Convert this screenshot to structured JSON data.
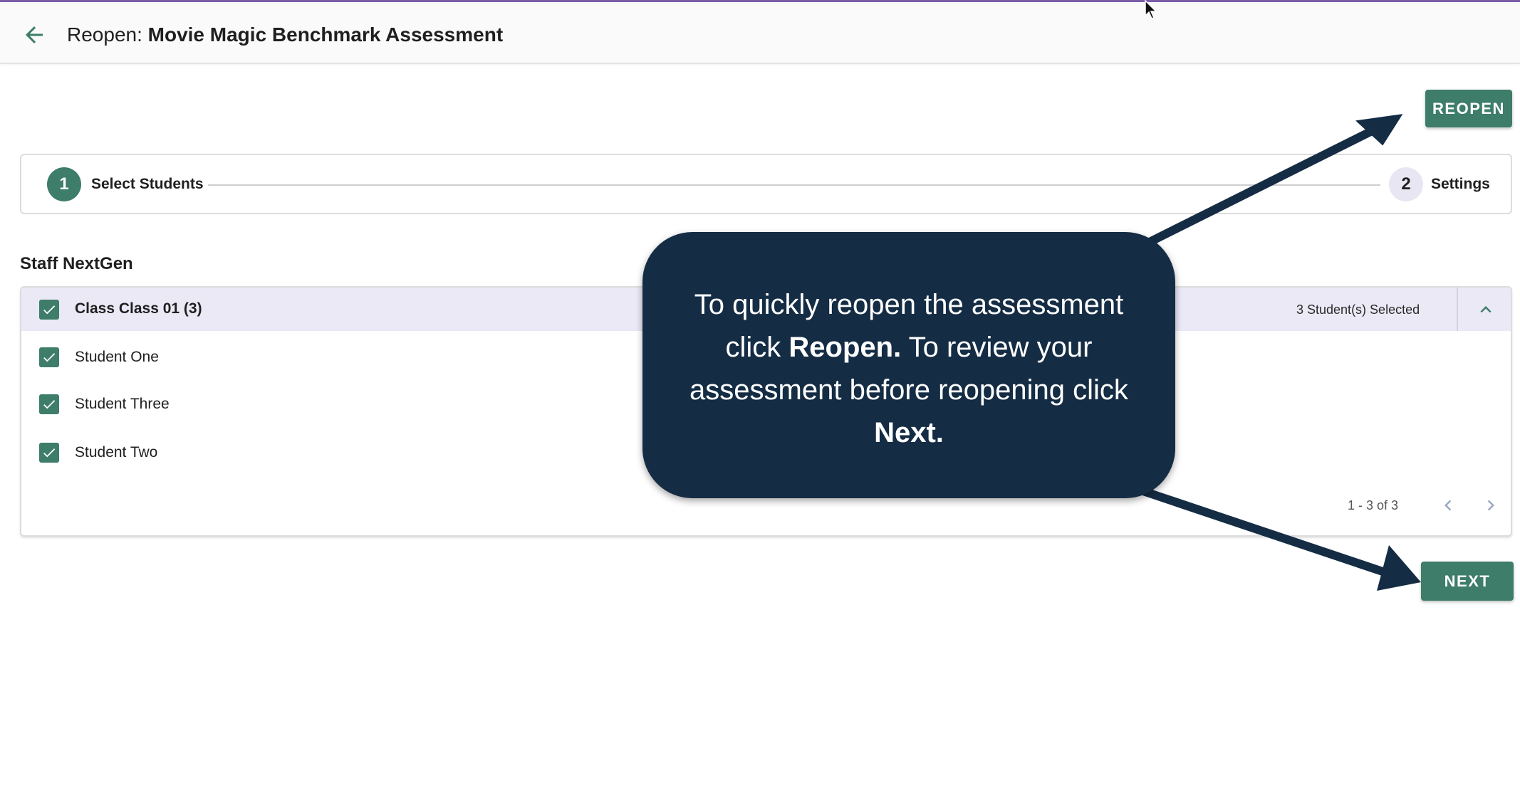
{
  "header": {
    "title_prefix": "Reopen:",
    "title_name": "Movie Magic Benchmark Assessment"
  },
  "actions": {
    "reopen_label": "REOPEN",
    "next_label": "NEXT"
  },
  "stepper": {
    "steps": [
      {
        "number": "1",
        "label": "Select Students",
        "active": true
      },
      {
        "number": "2",
        "label": "Settings",
        "active": false
      }
    ]
  },
  "staff_group": {
    "title": "Staff NextGen",
    "class_label": "Class Class 01 (3)",
    "selected_count": "3 Student(s) Selected",
    "students": [
      {
        "name": "Student One",
        "checked": true
      },
      {
        "name": "Student Three",
        "checked": true
      },
      {
        "name": "Student Two",
        "checked": true
      }
    ],
    "pagination": "1 - 3 of 3"
  },
  "callout": {
    "part1": "To quickly reopen the assessment click ",
    "bold1": "Reopen.",
    "part2": " To review your assessment before reopening click ",
    "bold2": "Next."
  },
  "colors": {
    "accent": "#3d7d69",
    "callout_bg": "#142c44",
    "class_row_bg": "#ebe9f5",
    "top_line": "#7b5ea7"
  }
}
